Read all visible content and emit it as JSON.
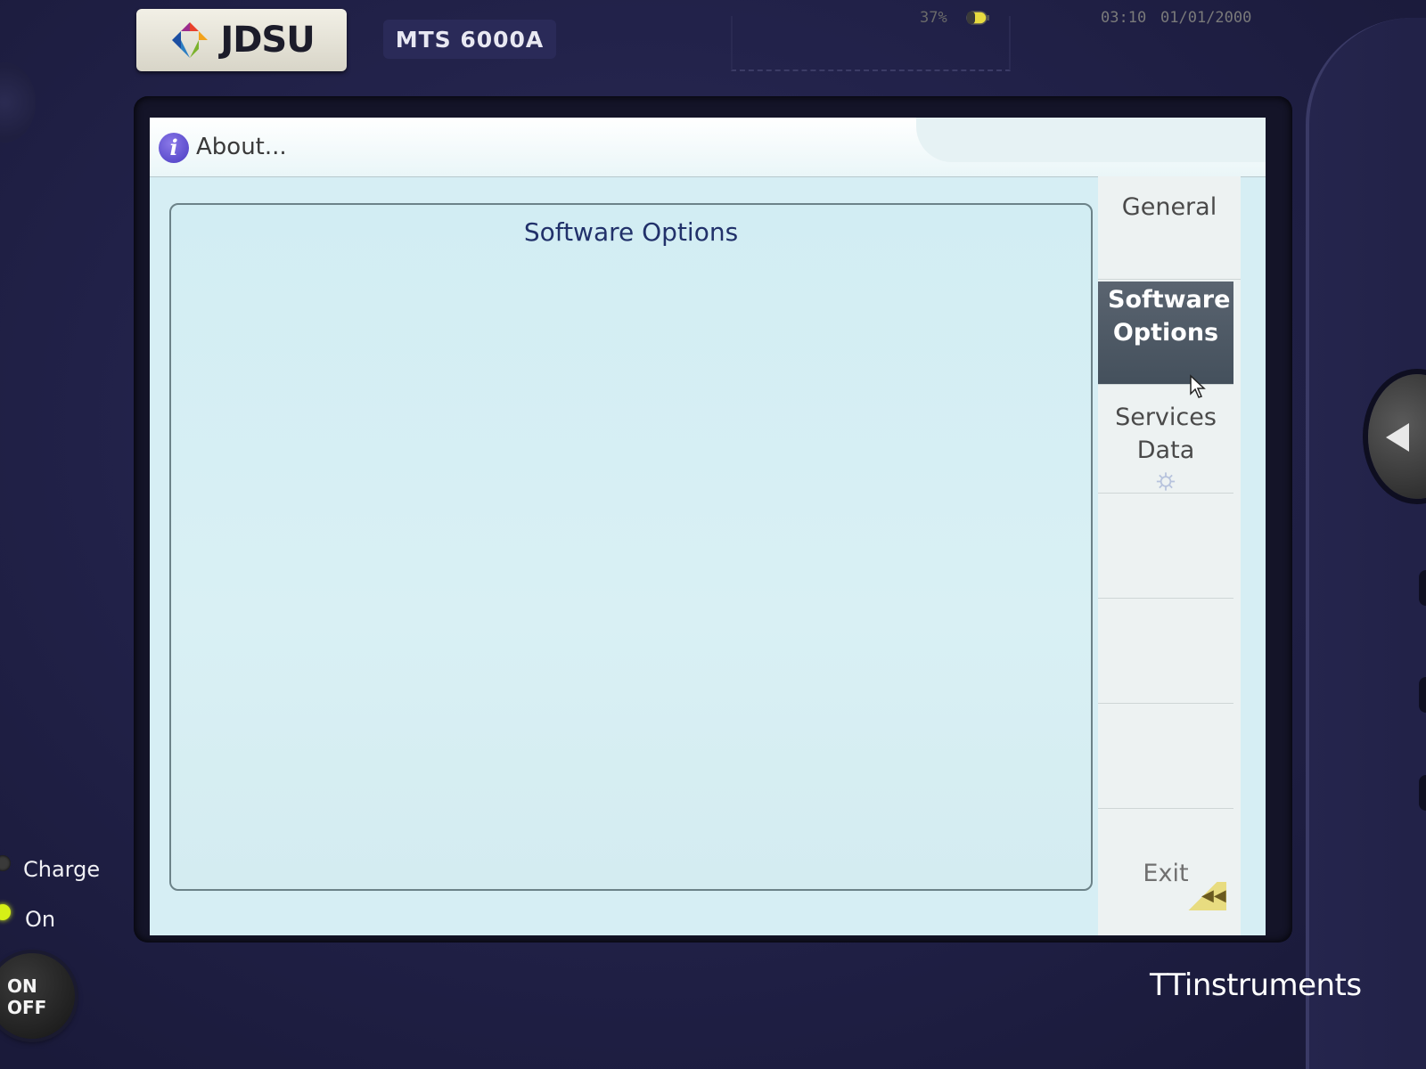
{
  "device": {
    "brand": "JDSU",
    "model": "MTS 6000A",
    "leds": {
      "charge_label": "Charge",
      "on_label": "On"
    },
    "power_button": {
      "line1": "ON",
      "line2": "OFF"
    }
  },
  "window": {
    "title": "About...",
    "icon": "info-icon"
  },
  "status": {
    "battery_percent": "37%",
    "battery_icon": "battery-icon",
    "time": "03:10",
    "date": "01/01/2000"
  },
  "content": {
    "panel_title": "Software Options"
  },
  "sidebar": {
    "items": [
      {
        "label": "General",
        "active": false
      },
      {
        "label": "Software Options",
        "active": true
      },
      {
        "label": "Services Data",
        "active": false,
        "icon": "gear-icon"
      },
      {
        "label": "",
        "active": false
      },
      {
        "label": "",
        "active": false
      },
      {
        "label": "",
        "active": false
      },
      {
        "label": "Exit",
        "active": false
      }
    ]
  },
  "colors": {
    "screen_bg": "#d6eef4",
    "active_button": "#4a5662",
    "panel_title": "#21316a",
    "device_body": "#22224a"
  },
  "watermark": "TTinstruments"
}
